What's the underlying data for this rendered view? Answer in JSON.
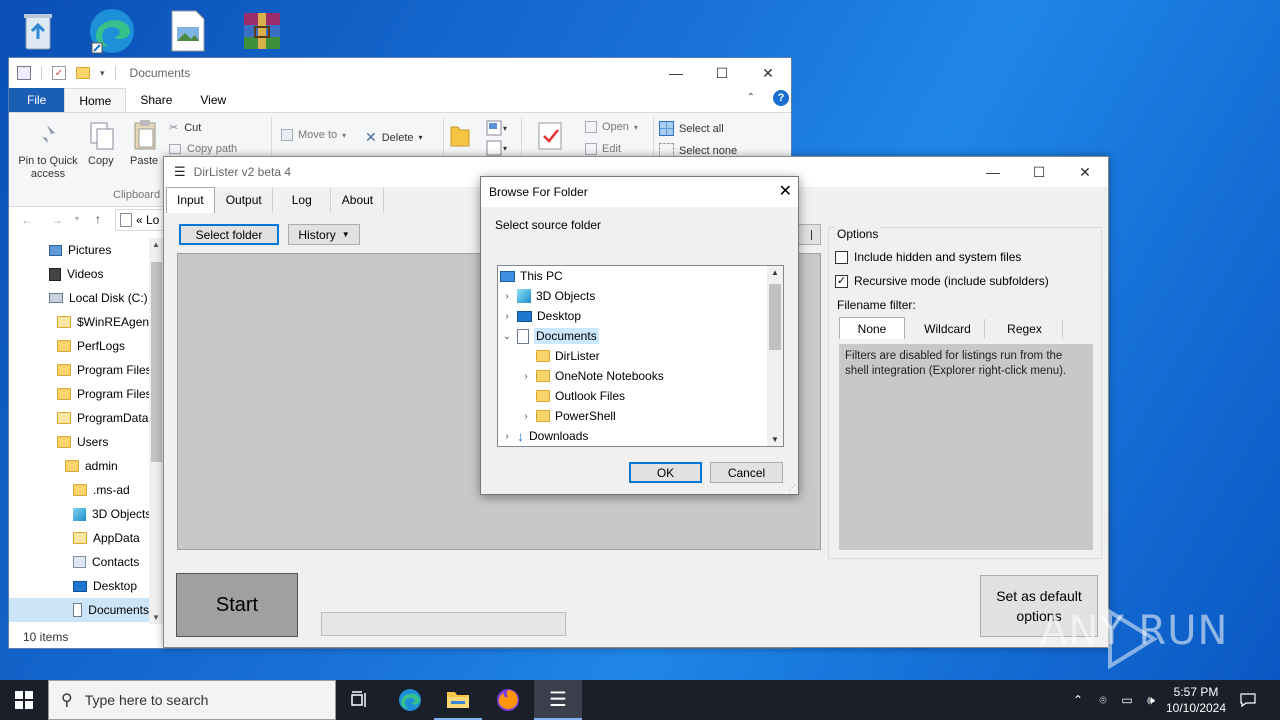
{
  "explorer": {
    "title": "Documents",
    "tabs": [
      "File",
      "Home",
      "Share",
      "View"
    ],
    "ribbon": {
      "pin_label": "Pin to Quick access",
      "copy_label": "Copy",
      "paste_label": "Paste",
      "cut_label": "Cut",
      "copy_path_label": "Copy path",
      "clipboard_label": "Clipboard",
      "move_to_label": "Move to",
      "delete_label": "Delete",
      "open_label": "Open",
      "edit_label": "Edit",
      "select_all_label": "Select all",
      "select_none_label": "Select none"
    },
    "address_text": "« Lo",
    "nav_items": [
      {
        "label": "Pictures"
      },
      {
        "label": "Videos"
      },
      {
        "label": "Local Disk (C:)"
      },
      {
        "label": "$WinREAgent"
      },
      {
        "label": "PerfLogs"
      },
      {
        "label": "Program Files"
      },
      {
        "label": "Program Files"
      },
      {
        "label": "ProgramData"
      },
      {
        "label": "Users"
      },
      {
        "label": "admin"
      },
      {
        "label": ".ms-ad"
      },
      {
        "label": "3D Objects"
      },
      {
        "label": "AppData"
      },
      {
        "label": "Contacts"
      },
      {
        "label": "Desktop"
      },
      {
        "label": "Documents"
      }
    ],
    "status": "10 items"
  },
  "dirlister": {
    "title": "DirLister v2 beta 4",
    "tabs": [
      "Input",
      "Output",
      "Log",
      "About"
    ],
    "select_folder_label": "Select folder",
    "history_label": "History",
    "options_title": "Options",
    "include_hidden_label": "Include hidden and system files",
    "include_hidden_checked": false,
    "recursive_label": "Recursive mode (include subfolders)",
    "recursive_checked": true,
    "filename_filter_label": "Filename filter:",
    "filter_tabs": [
      "None",
      "Wildcard",
      "Regex"
    ],
    "filter_note": "Filters are disabled for listings run from the shell integration (Explorer right-click menu).",
    "start_label": "Start",
    "set_default_label": "Set as default options"
  },
  "browse": {
    "title": "Browse For Folder",
    "prompt": "Select source folder",
    "tree": [
      {
        "label": "This PC",
        "icon": "pc-icon",
        "expander": "",
        "level": 0
      },
      {
        "label": "3D Objects",
        "icon": "cube-icon",
        "expander": ">",
        "level": 1
      },
      {
        "label": "Desktop",
        "icon": "desktop-icon",
        "expander": ">",
        "level": 1
      },
      {
        "label": "Documents",
        "icon": "documents-icon",
        "expander": "v",
        "level": 1,
        "selected": true
      },
      {
        "label": "DirLister",
        "icon": "folder-icon",
        "expander": "",
        "level": 2
      },
      {
        "label": "OneNote Notebooks",
        "icon": "folder-icon",
        "expander": ">",
        "level": 2
      },
      {
        "label": "Outlook Files",
        "icon": "folder-icon",
        "expander": "",
        "level": 2
      },
      {
        "label": "PowerShell",
        "icon": "folder-icon",
        "expander": ">",
        "level": 2
      },
      {
        "label": "Downloads",
        "icon": "download-icon",
        "expander": ">",
        "level": 1
      }
    ],
    "ok_label": "OK",
    "cancel_label": "Cancel"
  },
  "taskbar": {
    "search_placeholder": "Type here to search",
    "time": "5:57 PM",
    "date": "10/10/2024"
  },
  "watermark": "ANY RUN",
  "colors": {
    "accent": "#0078d7",
    "file_tab": "#1a5fb4",
    "taskbar": "#1b1f2a",
    "selection": "#cce8ff"
  }
}
